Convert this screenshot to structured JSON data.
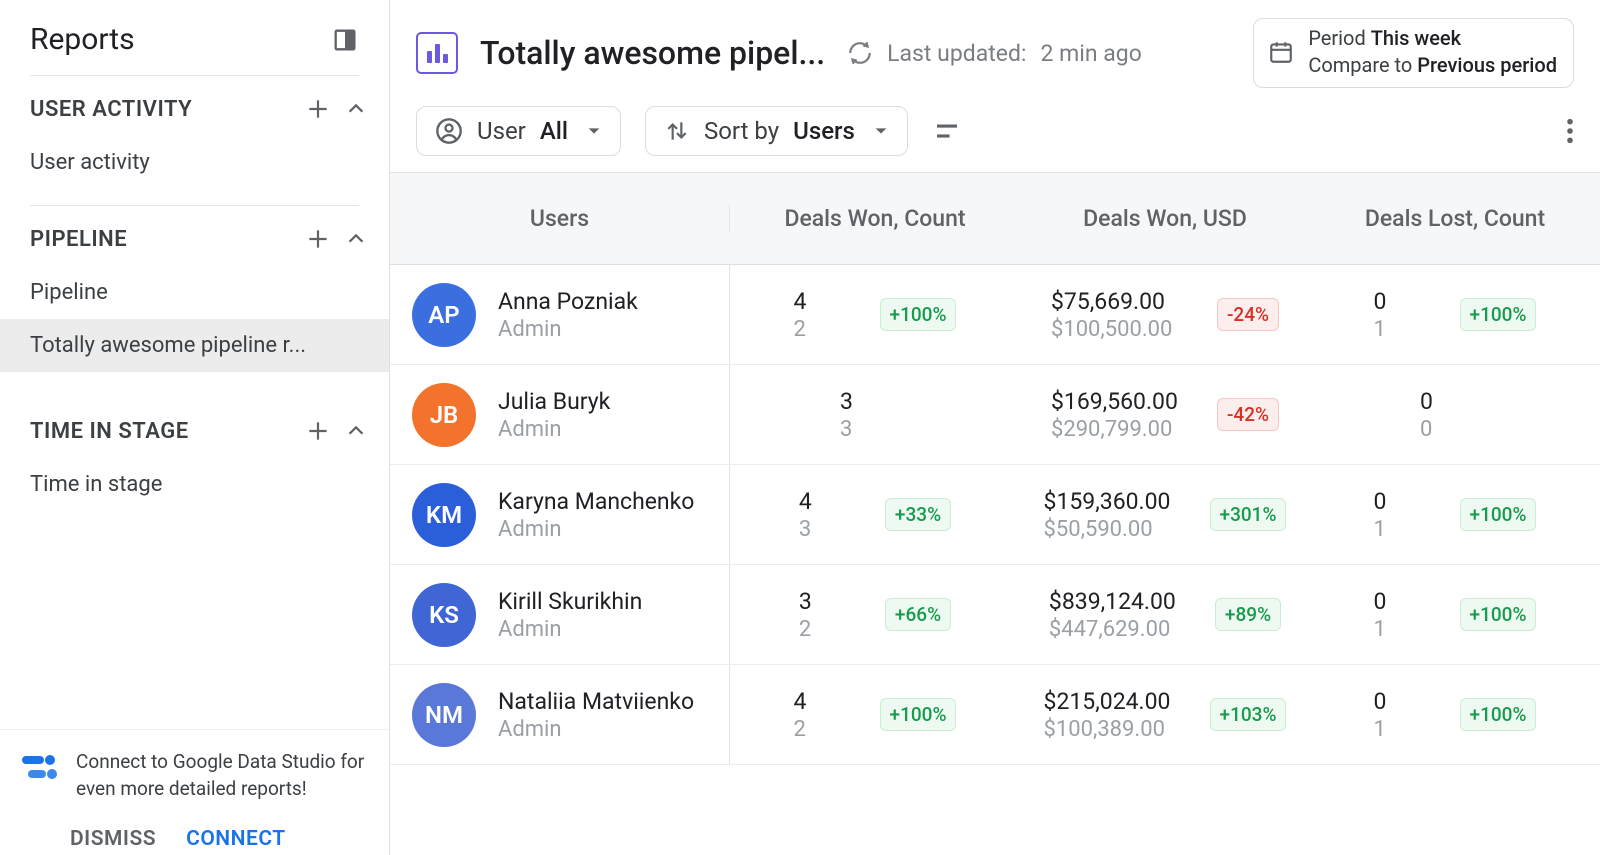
{
  "sidebar": {
    "title": "Reports",
    "sections": [
      {
        "title": "USER ACTIVITY",
        "items": [
          "User activity"
        ]
      },
      {
        "title": "PIPELINE",
        "items": [
          "Pipeline",
          "Totally awesome pipeline r..."
        ],
        "active_index": 1
      },
      {
        "title": "TIME IN STAGE",
        "items": [
          "Time in stage"
        ]
      }
    ],
    "footer": {
      "text": "Connect to Google Data Studio for even more detailed reports!",
      "dismiss": "DISMISS",
      "connect": "CONNECT"
    }
  },
  "header": {
    "title": "Totally awesome pipel...",
    "updated_label": "Last updated:",
    "updated_value": "2 min ago",
    "period_label": "Period",
    "period_value": "This week",
    "compare_label": "Compare to",
    "compare_value": "Previous period"
  },
  "filters": {
    "user_label": "User",
    "user_value": "All",
    "sort_label": "Sort by",
    "sort_value": "Users"
  },
  "table": {
    "columns": [
      "Users",
      "Deals Won, Count",
      "Deals Won, USD",
      "Deals Lost, Count"
    ],
    "rows": [
      {
        "name": "Anna Pozniak",
        "role": "Admin",
        "avatar_bg": "#3b6fe0",
        "initials": "AP",
        "m1": {
          "v1": "4",
          "v2": "2",
          "delta": "+100%",
          "dir": "pos"
        },
        "m2": {
          "v1": "$75,669.00",
          "v2": "$100,500.00",
          "delta": "-24%",
          "dir": "neg"
        },
        "m3": {
          "v1": "0",
          "v2": "1",
          "delta": "+100%",
          "dir": "pos"
        }
      },
      {
        "name": "Julia Buryk",
        "role": "Admin",
        "avatar_bg": "#f3722c",
        "initials": "JB",
        "m1": {
          "v1": "3",
          "v2": "3",
          "delta": "",
          "dir": ""
        },
        "m2": {
          "v1": "$169,560.00",
          "v2": "$290,799.00",
          "delta": "-42%",
          "dir": "neg"
        },
        "m3": {
          "v1": "0",
          "v2": "0",
          "delta": "",
          "dir": ""
        }
      },
      {
        "name": "Karyna Manchenko",
        "role": "Admin",
        "avatar_bg": "#2b5fd9",
        "initials": "KM",
        "m1": {
          "v1": "4",
          "v2": "3",
          "delta": "+33%",
          "dir": "pos"
        },
        "m2": {
          "v1": "$159,360.00",
          "v2": "$50,590.00",
          "delta": "+301%",
          "dir": "pos"
        },
        "m3": {
          "v1": "0",
          "v2": "1",
          "delta": "+100%",
          "dir": "pos"
        }
      },
      {
        "name": "Kirill Skurikhin",
        "role": "Admin",
        "avatar_bg": "#3f66d4",
        "initials": "KS",
        "m1": {
          "v1": "3",
          "v2": "2",
          "delta": "+66%",
          "dir": "pos"
        },
        "m2": {
          "v1": "$839,124.00",
          "v2": "$447,629.00",
          "delta": "+89%",
          "dir": "pos"
        },
        "m3": {
          "v1": "0",
          "v2": "1",
          "delta": "+100%",
          "dir": "pos"
        }
      },
      {
        "name": "Nataliia Matviienko",
        "role": "Admin",
        "avatar_bg": "#5a78d8",
        "initials": "NM",
        "m1": {
          "v1": "4",
          "v2": "2",
          "delta": "+100%",
          "dir": "pos"
        },
        "m2": {
          "v1": "$215,024.00",
          "v2": "$100,389.00",
          "delta": "+103%",
          "dir": "pos"
        },
        "m3": {
          "v1": "0",
          "v2": "1",
          "delta": "+100%",
          "dir": "pos"
        }
      }
    ]
  }
}
